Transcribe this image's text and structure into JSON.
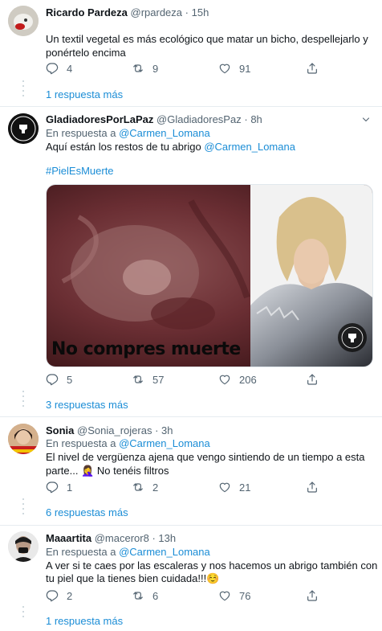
{
  "tweets": [
    {
      "name": "Ricardo Pardeza",
      "handle": "@rpardeza",
      "time": "15h",
      "text": [
        "Un textil vegetal es más ecológico que matar un bicho, despellejarlo y",
        "ponértelo encima"
      ],
      "replies": "4",
      "retweets": "9",
      "likes": "91",
      "more": "1 respuesta más"
    },
    {
      "name": "GladiadoresPorLaPaz",
      "handle": "@GladiadoresPaz",
      "time": "8h",
      "reply_prefix": "En respuesta a",
      "reply_to": "@Carmen_Lomana",
      "text_prefix": "Aquí están los restos de tu abrigo",
      "mention": "@Carmen_Lomana",
      "hashtag": "#PielEsMuerte",
      "image_caption": "No compres muerte",
      "logo_text": "GLADIADORES POR LA PAZ",
      "replies": "5",
      "retweets": "57",
      "likes": "206",
      "more": "3 respuestas más"
    },
    {
      "name": "Sonia",
      "handle": "@Sonia_rojeras",
      "time": "3h",
      "reply_prefix": "En respuesta a",
      "reply_to": "@Carmen_Lomana",
      "text": [
        "El nivel de vergüenza ajena que vengo sintiendo de un tiempo a esta",
        "parte... 🤦‍♀️ No tenéis filtros"
      ],
      "replies": "1",
      "retweets": "2",
      "likes": "21",
      "more": "6 respuestas más"
    },
    {
      "name": "Maaartita",
      "handle": "@maceror8",
      "time": "13h",
      "reply_prefix": "En respuesta a",
      "reply_to": "@Carmen_Lomana",
      "text": [
        "A ver si te caes por las escaleras y nos hacemos un abrigo también con",
        "tu piel que la tienes bien cuidada!!!☺️"
      ],
      "replies": "2",
      "retweets": "6",
      "likes": "76",
      "more": "1 respuesta más"
    }
  ],
  "dot": "·",
  "icons": {
    "reply": "reply-icon",
    "retweet": "retweet-icon",
    "like": "heart-icon",
    "share": "share-icon",
    "menu": "chevron-down-icon"
  },
  "colors": {
    "link": "#1b8dd6",
    "muted": "#536471",
    "separator": "#e6ecf0"
  }
}
